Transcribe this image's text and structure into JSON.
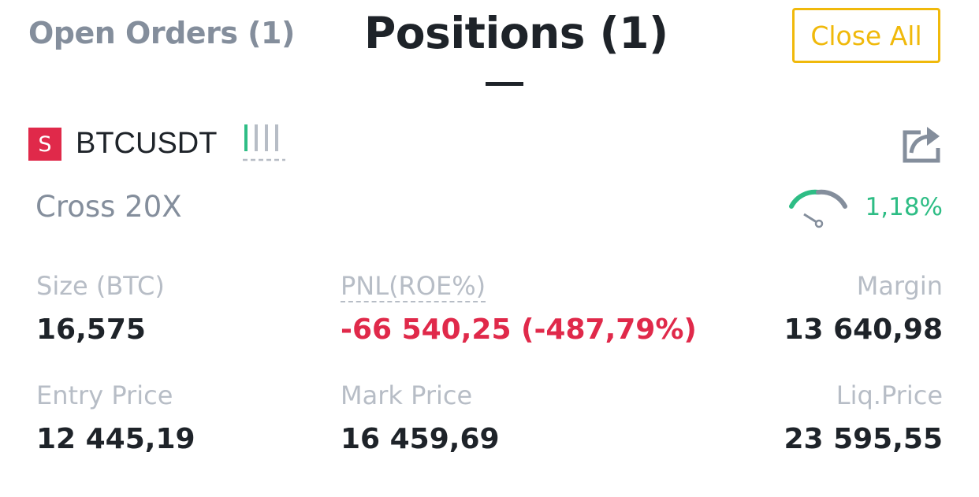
{
  "tabs": {
    "open_orders": "Open Orders (1)",
    "positions": "Positions  (1)",
    "close_all": "Close All"
  },
  "position": {
    "side_badge": "S",
    "symbol": "BTCUSDT",
    "margin_mode": "Cross 20X",
    "margin_ratio": "1,18%",
    "adl_icon": "adl-indicator-icon",
    "share_icon": "share-icon",
    "gauge_icon": "margin-ratio-gauge-icon",
    "adl_level": 1,
    "adl_levels_total": 5,
    "fields": {
      "size_label": "Size (BTC)",
      "size_value": "16,575",
      "pnl_label": "PNL(ROE%)",
      "pnl_value": "-66 540,25 (-487,79%)",
      "margin_label": "Margin",
      "margin_value": "13 640,98",
      "entry_label": "Entry Price",
      "entry_value": "12 445,19",
      "mark_label": "Mark Price",
      "mark_value": "16 459,69",
      "liq_label": "Liq.Price",
      "liq_value": "23 595,55"
    }
  },
  "colors": {
    "accent": "#f0b90b",
    "negative": "#e0294a",
    "positive": "#2ebd85",
    "text_primary": "#1e2329",
    "text_secondary": "#848e9c",
    "text_muted": "#b7bdc6"
  }
}
